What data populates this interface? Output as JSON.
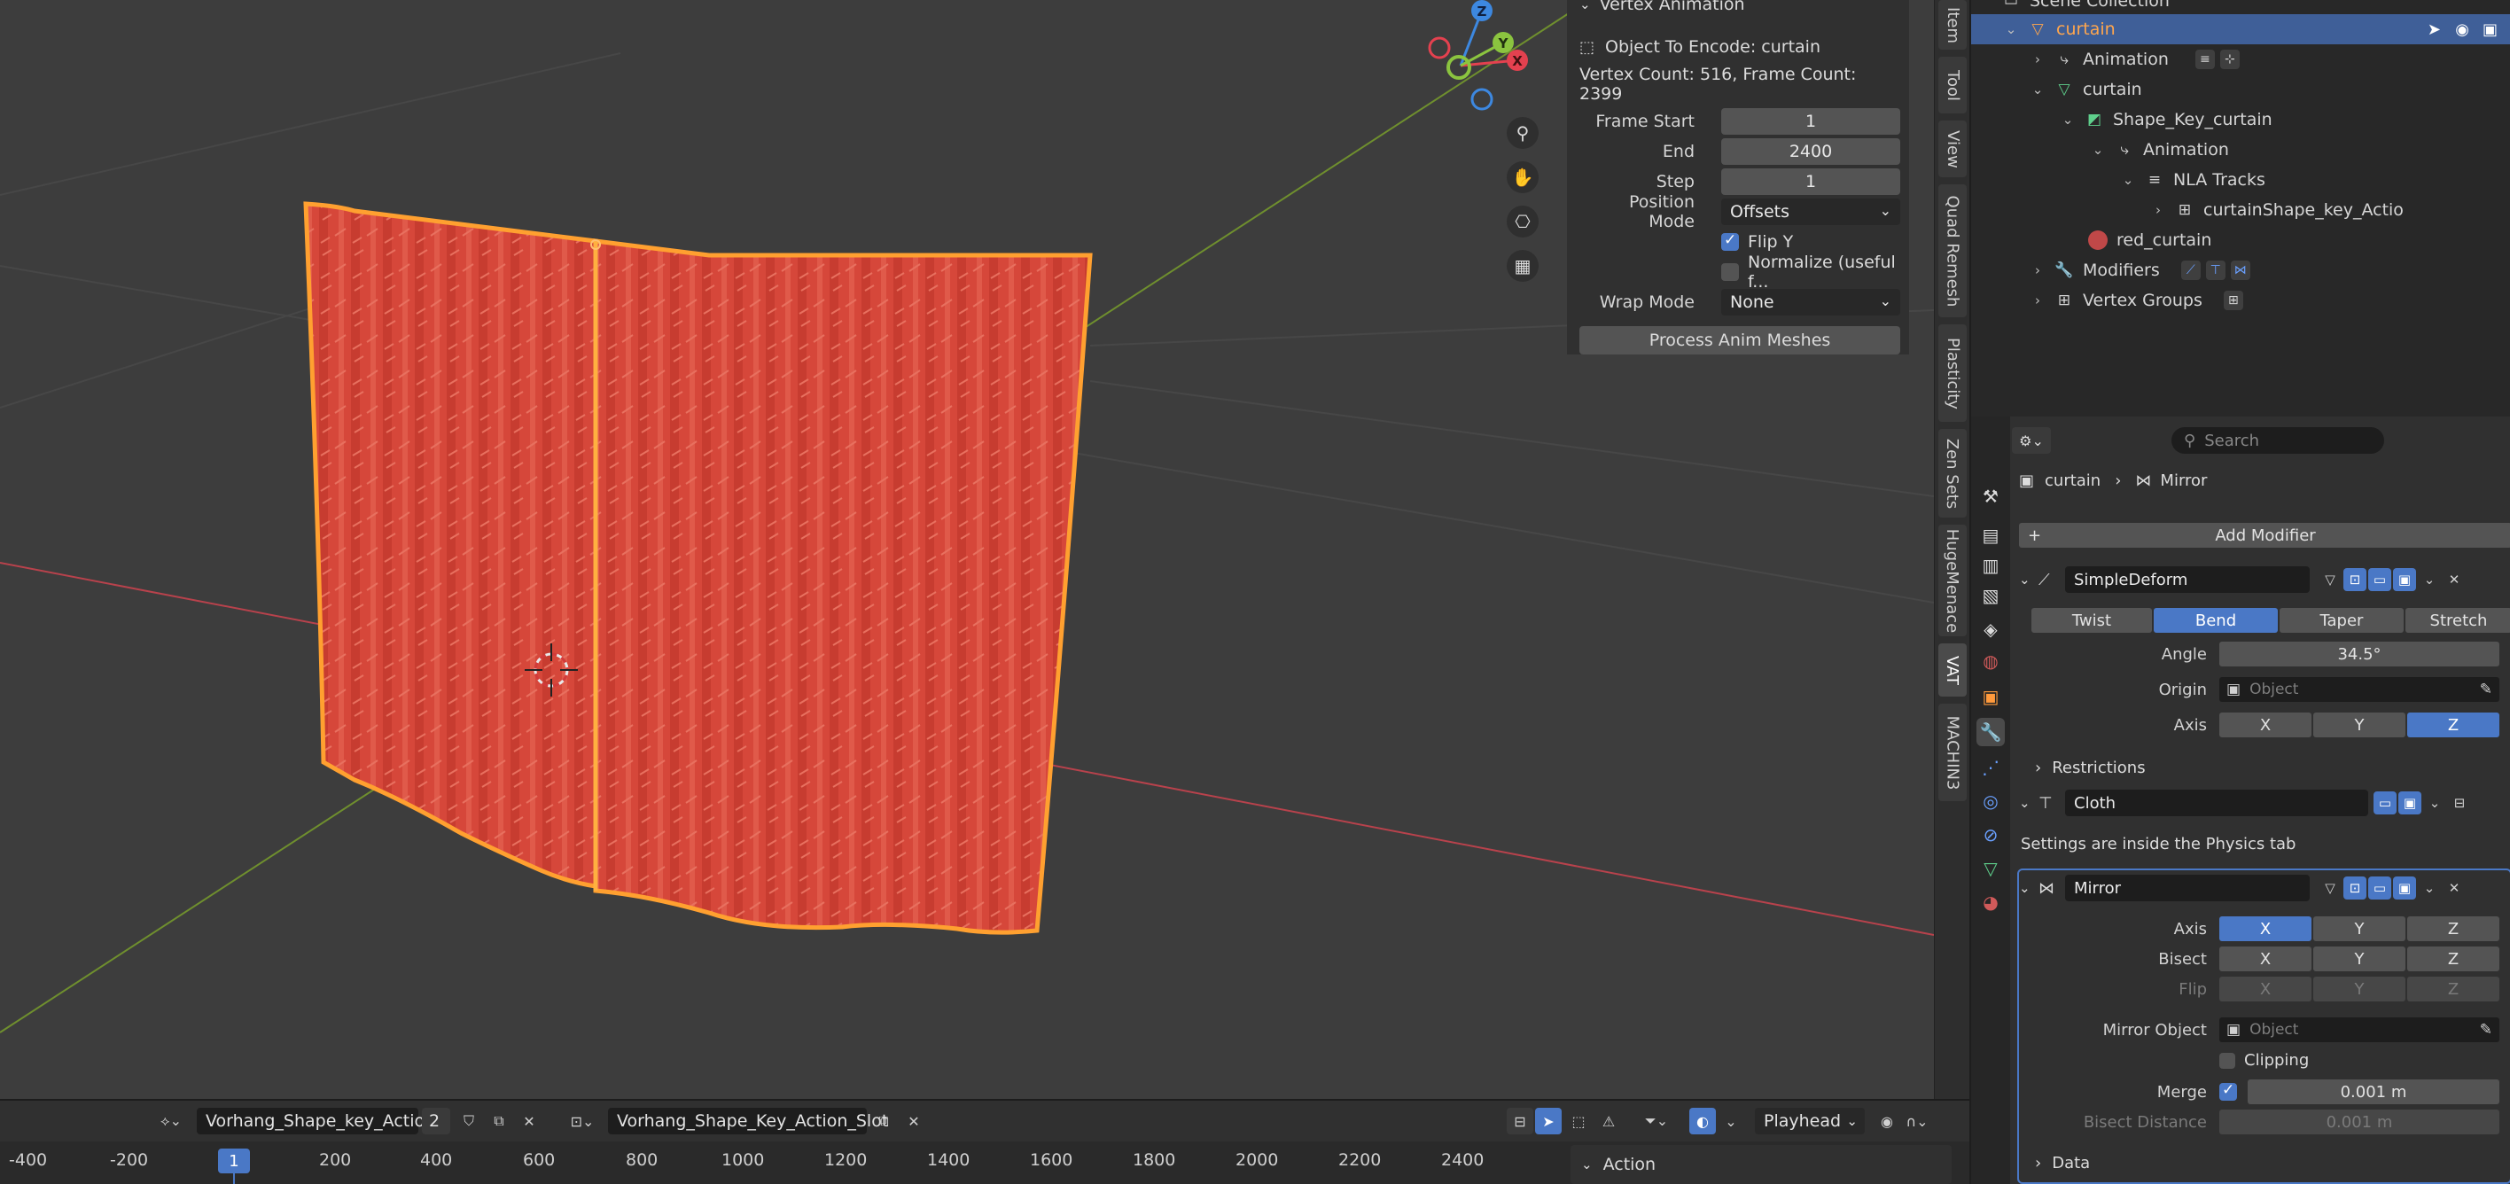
{
  "npanel": {
    "header": "Vertex Animation",
    "object_to_encode": "Object To Encode: curtain",
    "counts": "Vertex Count: 516, Frame Count: 2399",
    "frame_start_label": "Frame Start",
    "frame_start": "1",
    "end_label": "End",
    "end": "2400",
    "step_label": "Step",
    "step": "1",
    "position_mode_label": "Position Mode",
    "position_mode": "Offsets",
    "flip_y": "Flip Y",
    "flip_y_checked": true,
    "normalize": "Normalize (useful f...",
    "normalize_checked": false,
    "wrap_mode_label": "Wrap Mode",
    "wrap_mode": "None",
    "process_button": "Process Anim Meshes"
  },
  "side_tabs": [
    "Item",
    "Tool",
    "View",
    "Quad Remesh",
    "Plasticity",
    "Zen Sets",
    "HugeMenace",
    "VAT",
    "MACHIN3"
  ],
  "outliner": {
    "collection": "Scene Collection",
    "rows": [
      {
        "label": "curtain",
        "icon": "mesh-object-icon",
        "selected": true
      },
      {
        "label": "Animation",
        "icon": "animation-icon"
      },
      {
        "label": "curtain",
        "icon": "mesh-data-icon"
      },
      {
        "label": "Shape_Key_curtain",
        "icon": "shape-key-icon"
      },
      {
        "label": "Animation",
        "icon": "animation-icon"
      },
      {
        "label": "NLA Tracks",
        "icon": "nla-icon"
      },
      {
        "label": "curtainShape_key_Actio",
        "icon": "action-icon"
      },
      {
        "label": "red_curtain",
        "icon": "material-icon"
      },
      {
        "label": "Modifiers",
        "icon": "wrench-icon"
      },
      {
        "label": "Vertex Groups",
        "icon": "vertex-groups-icon"
      }
    ]
  },
  "properties": {
    "search_placeholder": "Search",
    "breadcrumb_object": "curtain",
    "breadcrumb_modifier": "Mirror",
    "add_modifier": "Add Modifier",
    "simpledeform": {
      "name": "SimpleDeform",
      "modes": [
        "Twist",
        "Bend",
        "Taper",
        "Stretch"
      ],
      "active_mode": "Bend",
      "angle_label": "Angle",
      "angle": "34.5°",
      "origin_label": "Origin",
      "origin_placeholder": "Object",
      "axis_label": "Axis",
      "axes": [
        "X",
        "Y",
        "Z"
      ],
      "active_axis": "Z",
      "restrictions": "Restrictions"
    },
    "cloth": {
      "name": "Cloth",
      "note": "Settings are inside the Physics tab"
    },
    "mirror": {
      "name": "Mirror",
      "axis_label": "Axis",
      "bisect_label": "Bisect",
      "flip_label": "Flip",
      "xyz": [
        "X",
        "Y",
        "Z"
      ],
      "mirror_object_label": "Mirror Object",
      "mirror_object_placeholder": "Object",
      "clipping": "Clipping",
      "merge_label": "Merge",
      "merge": "0.001 m",
      "bisect_distance_label": "Bisect Distance",
      "bisect_distance": "0.001 m",
      "data": "Data"
    }
  },
  "timeline": {
    "action_name": "Vorhang_Shape_key_Action",
    "users": "2",
    "slot_name": "Vorhang_Shape_Key_Action_Slot",
    "playhead": "Playhead",
    "current_frame": "1",
    "ticks": [
      "-400",
      "-200",
      "200",
      "400",
      "600",
      "800",
      "1000",
      "1200",
      "1400",
      "1600",
      "1800",
      "2000",
      "2200",
      "2400"
    ],
    "action_panel": "Action"
  },
  "colors": {
    "accent": "#4a78c6",
    "curtain": "#d9493a",
    "outline": "#ffa64d",
    "x_axis": "#e4414f",
    "y_axis": "#8bc43f",
    "z_axis": "#3d88e0"
  }
}
